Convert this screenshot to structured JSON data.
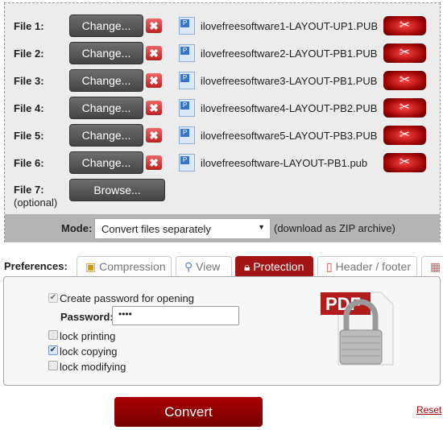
{
  "files": [
    {
      "label": "File 1:",
      "button": "Change...",
      "name": "ilovefreesoftware1-LAYOUT-UP1.PUB"
    },
    {
      "label": "File 2:",
      "button": "Change...",
      "name": "ilovefreesoftware2-LAYOUT-PB1.PUB"
    },
    {
      "label": "File 3:",
      "button": "Change...",
      "name": "ilovefreesoftware3-LAYOUT-PB1.PUB"
    },
    {
      "label": "File 4:",
      "button": "Change...",
      "name": "ilovefreesoftware4-LAYOUT-PB2.PUB"
    },
    {
      "label": "File 5:",
      "button": "Change...",
      "name": "ilovefreesoftware5-LAYOUT-PB3.PUB"
    },
    {
      "label": "File 6:",
      "button": "Change...",
      "name": "ilovefreesoftware-LAYOUT-PB1.pub"
    }
  ],
  "file7": {
    "label": "File 7:",
    "optional": "(optional)",
    "button": "Browse..."
  },
  "mode": {
    "label": "Mode:",
    "selected": "Convert files separately",
    "note": "(download as ZIP archive)"
  },
  "preferences": {
    "label": "Preferences:",
    "tabs": [
      {
        "label": "Compression",
        "icon": "compression-icon"
      },
      {
        "label": "View",
        "icon": "magnifier-icon"
      },
      {
        "label": "Protection",
        "icon": "lock-icon",
        "active": true
      },
      {
        "label": "Header / footer",
        "icon": "page-icon"
      },
      {
        "label": "",
        "icon": "grid-icon"
      }
    ]
  },
  "protection": {
    "create_password": {
      "label": "Create password for opening",
      "checked": true,
      "disabled": true
    },
    "password_label": "Password:",
    "password_value": "••••",
    "lock_printing": {
      "label": "lock printing",
      "checked": false
    },
    "lock_copying": {
      "label": "lock copying",
      "checked": true
    },
    "lock_modifying": {
      "label": "lock modifying",
      "checked": false
    },
    "image_text": "PDF"
  },
  "convert_label": "Convert",
  "reset_label": "Reset",
  "colors": {
    "accent": "#a31515",
    "button_dark": "#555555"
  }
}
